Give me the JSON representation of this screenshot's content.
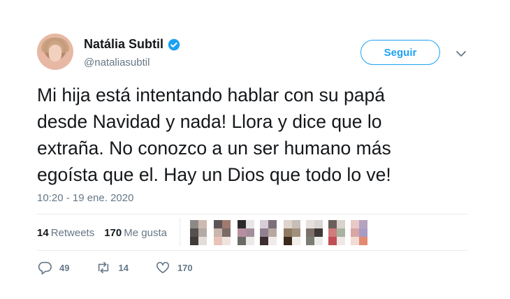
{
  "user": {
    "name": "Natália Subtil",
    "handle": "@nataliasubtil"
  },
  "follow_label": "Seguir",
  "tweet": {
    "text": "Mi hija está intentando hablar con su papá\ndesde Navidad y nada! Llora y dice que lo\nextraña. No conozco a un ser humano más\negoísta que el. Hay un Dios que todo lo ve!",
    "timestamp": "10:20 - 19 ene. 2020"
  },
  "stats": {
    "retweets_count": "14",
    "retweets_label": "Retweets",
    "likes_count": "170",
    "likes_label": "Me gusta"
  },
  "actions": {
    "replies": "49",
    "retweets": "14",
    "likes": "170"
  },
  "colors": {
    "accent": "#1da1f2",
    "text": "#14171a",
    "muted": "#657786",
    "divider": "#e6ecf0"
  }
}
